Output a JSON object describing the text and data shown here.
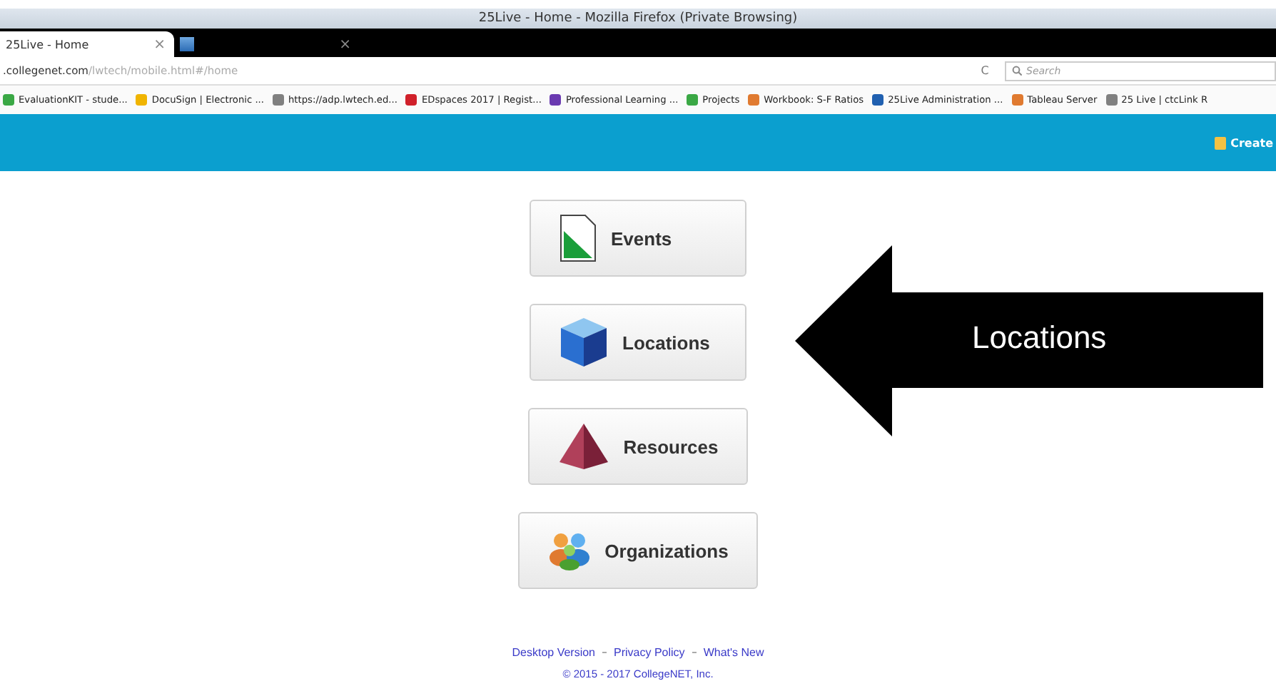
{
  "window": {
    "title": "25Live - Home - Mozilla Firefox (Private Browsing)"
  },
  "tabs": [
    {
      "label": "25Live - Home",
      "close": "×",
      "selected": true
    },
    {
      "close": "×",
      "selected": false
    }
  ],
  "address_bar": {
    "url_host": ".collegenet.com",
    "url_path": "/lwtech/mobile.html#/home",
    "reload": "C",
    "search_placeholder": "Search"
  },
  "bookmarks": [
    {
      "label": "EvaluationKIT - stude...",
      "color": "#3aa845"
    },
    {
      "label": "DocuSign | Electronic ...",
      "color": "#f0b400"
    },
    {
      "label": "https://adp.lwtech.ed...",
      "color": "#808080"
    },
    {
      "label": "EDspaces 2017 | Regist...",
      "color": "#d0202a"
    },
    {
      "label": "Professional Learning ...",
      "color": "#6a3ab0"
    },
    {
      "label": "Projects",
      "color": "#3aa845"
    },
    {
      "label": "Workbook: S-F Ratios",
      "color": "#e07a30"
    },
    {
      "label": "25Live Administration ...",
      "color": "#2060b0"
    },
    {
      "label": "Tableau Server",
      "color": "#e07a30"
    },
    {
      "label": "25 Live | ctcLink R",
      "color": "#808080"
    }
  ],
  "header": {
    "create_label": "Create"
  },
  "menu": [
    {
      "label": "Events",
      "kind": "document"
    },
    {
      "label": "Locations",
      "kind": "cube"
    },
    {
      "label": "Resources",
      "kind": "pyramid"
    },
    {
      "label": "Organizations",
      "kind": "people"
    }
  ],
  "footer": {
    "links": [
      "Desktop Version",
      "Privacy Policy",
      "What's New"
    ],
    "copyright": "© 2015 - 2017 CollegeNET, Inc."
  },
  "callout": {
    "label": "Locations"
  }
}
